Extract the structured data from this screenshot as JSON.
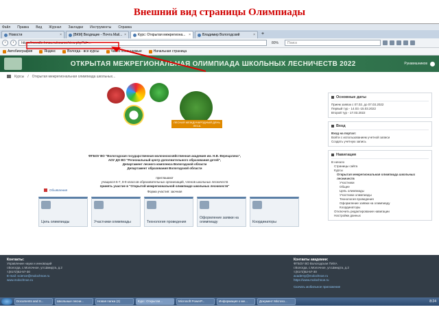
{
  "slide_title": "Внешний вид страницы Олимпиады",
  "menu": [
    "Файл",
    "Правка",
    "Вид",
    "Журнал",
    "Закладки",
    "Инструменты",
    "Справка"
  ],
  "tabs": [
    {
      "label": "Новости"
    },
    {
      "label": "[ВКМ] Входящие - Почта Mail..."
    },
    {
      "label": "Курс: Открытая межрегиона..."
    },
    {
      "label": "Владимир Вологодский"
    }
  ],
  "url": "https://moodle.hmsu.ru/course/view.php?id=...",
  "zoom": "80%",
  "search_placeholder": "Поиск",
  "bookmarks": [
    "Автобиография",
    "Яндекс",
    "Вологда - все курсы",
    "Часто посещаемые",
    "Начальная страница"
  ],
  "banner_title": "Открытая межрегиональная олимпиада школьных лесничеств 2022",
  "banner_user": "Рукавишников",
  "breadcrumb": [
    "Курсы",
    "Открытая межрегиональная олимпиада школьных..."
  ],
  "logo_banner": "ЛЕСНАЯ МЕЖДУНАРОДНЫЙ ДЕНЬ ЛЕСА",
  "org_text": [
    "ФГБОУ ВО \"Вологодская государственная молочнохозяйственная академия им. Н.В. Верещагина\",",
    "АОУ ДО ВО \"Региональный центр дополнительного образования детей\",",
    "Департамент лесного комплекса Вологодской области",
    "Департамент образования Вологодской области"
  ],
  "invite_text": [
    "приглашают",
    "учащихся 6-7, 8-9 классов образовательных организаций, членов школьных лесничеств",
    "принять участие в \"Открытой межрегиональной олимпиаде школьных лесничеств\""
  ],
  "form_text": "Форма участия: заочная",
  "announcements": "Объявления",
  "tiles": [
    "Цель олимпиады",
    "Участники олимпиады",
    "Технология проведения",
    "Оформление заявки на олимпиаду",
    "Координаторы"
  ],
  "sidebar": {
    "dates_title": "Основные даты",
    "dates": [
      "Прием заявок с 07.02. до 07.03.2022",
      "Первый тур - 14.03.-15.03.2022",
      "Второй тур - 17.03.2022"
    ],
    "login_title": "Вход",
    "login_items": [
      "Вход на портал:",
      "Войти с использованием учетной записи",
      "Создать учетную запись"
    ],
    "nav_title": "Навигация",
    "nav_items": [
      "В начало",
      "Страницы сайта",
      "Курсы",
      "Открытая межрегиональная олимпиада школьных лесничеств",
      "Участники",
      "Общее",
      "Цель олимпиады",
      "Участники олимпиады",
      "Технология проведения",
      "Оформление заявки на олимпиаду",
      "Координаторы",
      "Отключить редактирование навигации",
      "Настройки данных"
    ]
  },
  "footer": {
    "left_title": "Контакты:",
    "left_lines": [
      "Управление науки и инноваций",
      "г.Вологда, с.Молочное, ул.Шмидта, д.2",
      "т.(8172)52-57-30",
      "E-mail: science@molochnoe.ru",
      "www.molochnoe.ru"
    ],
    "right_title": "Контакты академии:",
    "right_lines": [
      "ФГБОУ ВО Вологодская ГМХА",
      "г.Вологда, с.Молочное, ул.Шмидта, д.2",
      "т.(8172)52-57-30",
      "academy@molochnoe.ru",
      "https://www.molochnoe.ru"
    ],
    "bottom_link": "Скачать мобильное приложение"
  },
  "taskbar": [
    "Documents and S...",
    "Школьные лесни...",
    "Новая папка (2)",
    "Курс: Открытая...",
    "Microsoft PowerP...",
    "Информация о ме...",
    "Документ Microso..."
  ],
  "clock": "8:24",
  "colors": {
    "banner": "#2d6d49",
    "title": "#d00000",
    "arrow": "#e00000",
    "footer": "#333d47"
  }
}
